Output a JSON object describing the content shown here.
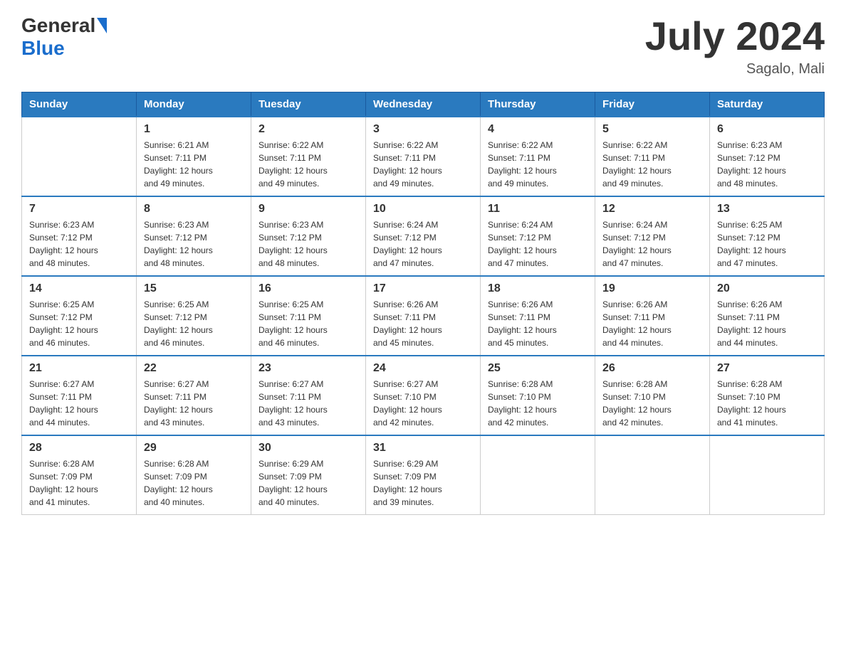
{
  "header": {
    "logo_general": "General",
    "logo_blue": "Blue",
    "title": "July 2024",
    "location": "Sagalo, Mali"
  },
  "days_of_week": [
    "Sunday",
    "Monday",
    "Tuesday",
    "Wednesday",
    "Thursday",
    "Friday",
    "Saturday"
  ],
  "weeks": [
    [
      {
        "day": "",
        "info": ""
      },
      {
        "day": "1",
        "info": "Sunrise: 6:21 AM\nSunset: 7:11 PM\nDaylight: 12 hours\nand 49 minutes."
      },
      {
        "day": "2",
        "info": "Sunrise: 6:22 AM\nSunset: 7:11 PM\nDaylight: 12 hours\nand 49 minutes."
      },
      {
        "day": "3",
        "info": "Sunrise: 6:22 AM\nSunset: 7:11 PM\nDaylight: 12 hours\nand 49 minutes."
      },
      {
        "day": "4",
        "info": "Sunrise: 6:22 AM\nSunset: 7:11 PM\nDaylight: 12 hours\nand 49 minutes."
      },
      {
        "day": "5",
        "info": "Sunrise: 6:22 AM\nSunset: 7:11 PM\nDaylight: 12 hours\nand 49 minutes."
      },
      {
        "day": "6",
        "info": "Sunrise: 6:23 AM\nSunset: 7:12 PM\nDaylight: 12 hours\nand 48 minutes."
      }
    ],
    [
      {
        "day": "7",
        "info": "Sunrise: 6:23 AM\nSunset: 7:12 PM\nDaylight: 12 hours\nand 48 minutes."
      },
      {
        "day": "8",
        "info": "Sunrise: 6:23 AM\nSunset: 7:12 PM\nDaylight: 12 hours\nand 48 minutes."
      },
      {
        "day": "9",
        "info": "Sunrise: 6:23 AM\nSunset: 7:12 PM\nDaylight: 12 hours\nand 48 minutes."
      },
      {
        "day": "10",
        "info": "Sunrise: 6:24 AM\nSunset: 7:12 PM\nDaylight: 12 hours\nand 47 minutes."
      },
      {
        "day": "11",
        "info": "Sunrise: 6:24 AM\nSunset: 7:12 PM\nDaylight: 12 hours\nand 47 minutes."
      },
      {
        "day": "12",
        "info": "Sunrise: 6:24 AM\nSunset: 7:12 PM\nDaylight: 12 hours\nand 47 minutes."
      },
      {
        "day": "13",
        "info": "Sunrise: 6:25 AM\nSunset: 7:12 PM\nDaylight: 12 hours\nand 47 minutes."
      }
    ],
    [
      {
        "day": "14",
        "info": "Sunrise: 6:25 AM\nSunset: 7:12 PM\nDaylight: 12 hours\nand 46 minutes."
      },
      {
        "day": "15",
        "info": "Sunrise: 6:25 AM\nSunset: 7:12 PM\nDaylight: 12 hours\nand 46 minutes."
      },
      {
        "day": "16",
        "info": "Sunrise: 6:25 AM\nSunset: 7:11 PM\nDaylight: 12 hours\nand 46 minutes."
      },
      {
        "day": "17",
        "info": "Sunrise: 6:26 AM\nSunset: 7:11 PM\nDaylight: 12 hours\nand 45 minutes."
      },
      {
        "day": "18",
        "info": "Sunrise: 6:26 AM\nSunset: 7:11 PM\nDaylight: 12 hours\nand 45 minutes."
      },
      {
        "day": "19",
        "info": "Sunrise: 6:26 AM\nSunset: 7:11 PM\nDaylight: 12 hours\nand 44 minutes."
      },
      {
        "day": "20",
        "info": "Sunrise: 6:26 AM\nSunset: 7:11 PM\nDaylight: 12 hours\nand 44 minutes."
      }
    ],
    [
      {
        "day": "21",
        "info": "Sunrise: 6:27 AM\nSunset: 7:11 PM\nDaylight: 12 hours\nand 44 minutes."
      },
      {
        "day": "22",
        "info": "Sunrise: 6:27 AM\nSunset: 7:11 PM\nDaylight: 12 hours\nand 43 minutes."
      },
      {
        "day": "23",
        "info": "Sunrise: 6:27 AM\nSunset: 7:11 PM\nDaylight: 12 hours\nand 43 minutes."
      },
      {
        "day": "24",
        "info": "Sunrise: 6:27 AM\nSunset: 7:10 PM\nDaylight: 12 hours\nand 42 minutes."
      },
      {
        "day": "25",
        "info": "Sunrise: 6:28 AM\nSunset: 7:10 PM\nDaylight: 12 hours\nand 42 minutes."
      },
      {
        "day": "26",
        "info": "Sunrise: 6:28 AM\nSunset: 7:10 PM\nDaylight: 12 hours\nand 42 minutes."
      },
      {
        "day": "27",
        "info": "Sunrise: 6:28 AM\nSunset: 7:10 PM\nDaylight: 12 hours\nand 41 minutes."
      }
    ],
    [
      {
        "day": "28",
        "info": "Sunrise: 6:28 AM\nSunset: 7:09 PM\nDaylight: 12 hours\nand 41 minutes."
      },
      {
        "day": "29",
        "info": "Sunrise: 6:28 AM\nSunset: 7:09 PM\nDaylight: 12 hours\nand 40 minutes."
      },
      {
        "day": "30",
        "info": "Sunrise: 6:29 AM\nSunset: 7:09 PM\nDaylight: 12 hours\nand 40 minutes."
      },
      {
        "day": "31",
        "info": "Sunrise: 6:29 AM\nSunset: 7:09 PM\nDaylight: 12 hours\nand 39 minutes."
      },
      {
        "day": "",
        "info": ""
      },
      {
        "day": "",
        "info": ""
      },
      {
        "day": "",
        "info": ""
      }
    ]
  ]
}
